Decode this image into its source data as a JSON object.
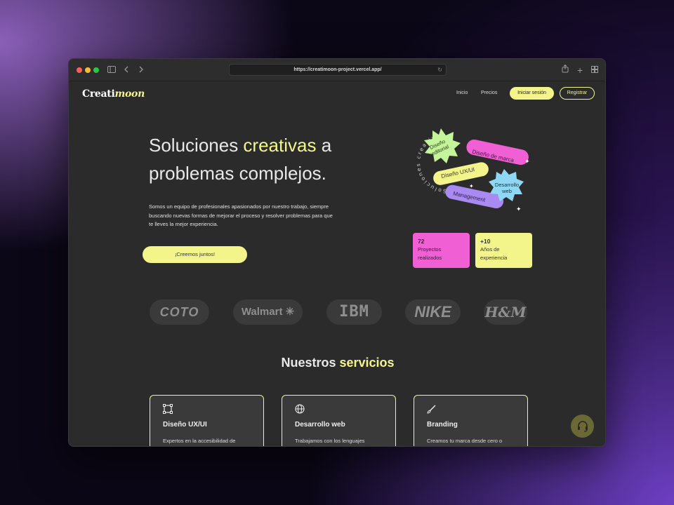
{
  "browser": {
    "url": "https://creatimoon-project.vercel.app/"
  },
  "header": {
    "logo_main": "Creati",
    "logo_accent": "moon",
    "nav": [
      "Inicio",
      "Precios"
    ],
    "login_label": "Iniciar sesión",
    "register_label": "Registrar"
  },
  "hero": {
    "title_part1": "Soluciones ",
    "title_highlight": "creativas",
    "title_part2": " a",
    "title_line2": "problemas complejos.",
    "description": "Somos un equipo de profesionales apasionados por nuestro trabajo, siempre buscando nuevas formas de mejorar el proceso y resolver problemas para que te lleves la mejor experiencia.",
    "cta_label": "¡Creemos juntos!"
  },
  "badges": {
    "editorial": "Diseño editorial",
    "marca": "Diseño de marca",
    "uxui": "Diseño UX/UI",
    "web": "Desarrollo web",
    "management": "Management",
    "circle_text": "Soluciones creativas"
  },
  "stats": [
    {
      "number": "72",
      "label": "Proyectos realizados"
    },
    {
      "number": "+10",
      "label": "Años de experiencia"
    }
  ],
  "brands": [
    "COTO",
    "Walmart",
    "IBM",
    "NIKE",
    "H&M"
  ],
  "services": {
    "title_part1": "Nuestros ",
    "title_highlight": "servicios",
    "cards": [
      {
        "icon": "frame-icon",
        "title": "Diseño UX/UI",
        "text": "Expertos en la accesibilidad de"
      },
      {
        "icon": "globe-icon",
        "title": "Desarrollo web",
        "text": "Trabajamos con los lenguajes"
      },
      {
        "icon": "brush-icon",
        "title": "Branding",
        "text": "Creamos tu marca desde cero o"
      }
    ]
  },
  "colors": {
    "accent_yellow": "#f3f58a",
    "accent_pink": "#f05fd4",
    "accent_blue": "#8fd8f5",
    "accent_green": "#c4f59a",
    "accent_purple": "#a98af0",
    "background": "#2b2b2b"
  }
}
